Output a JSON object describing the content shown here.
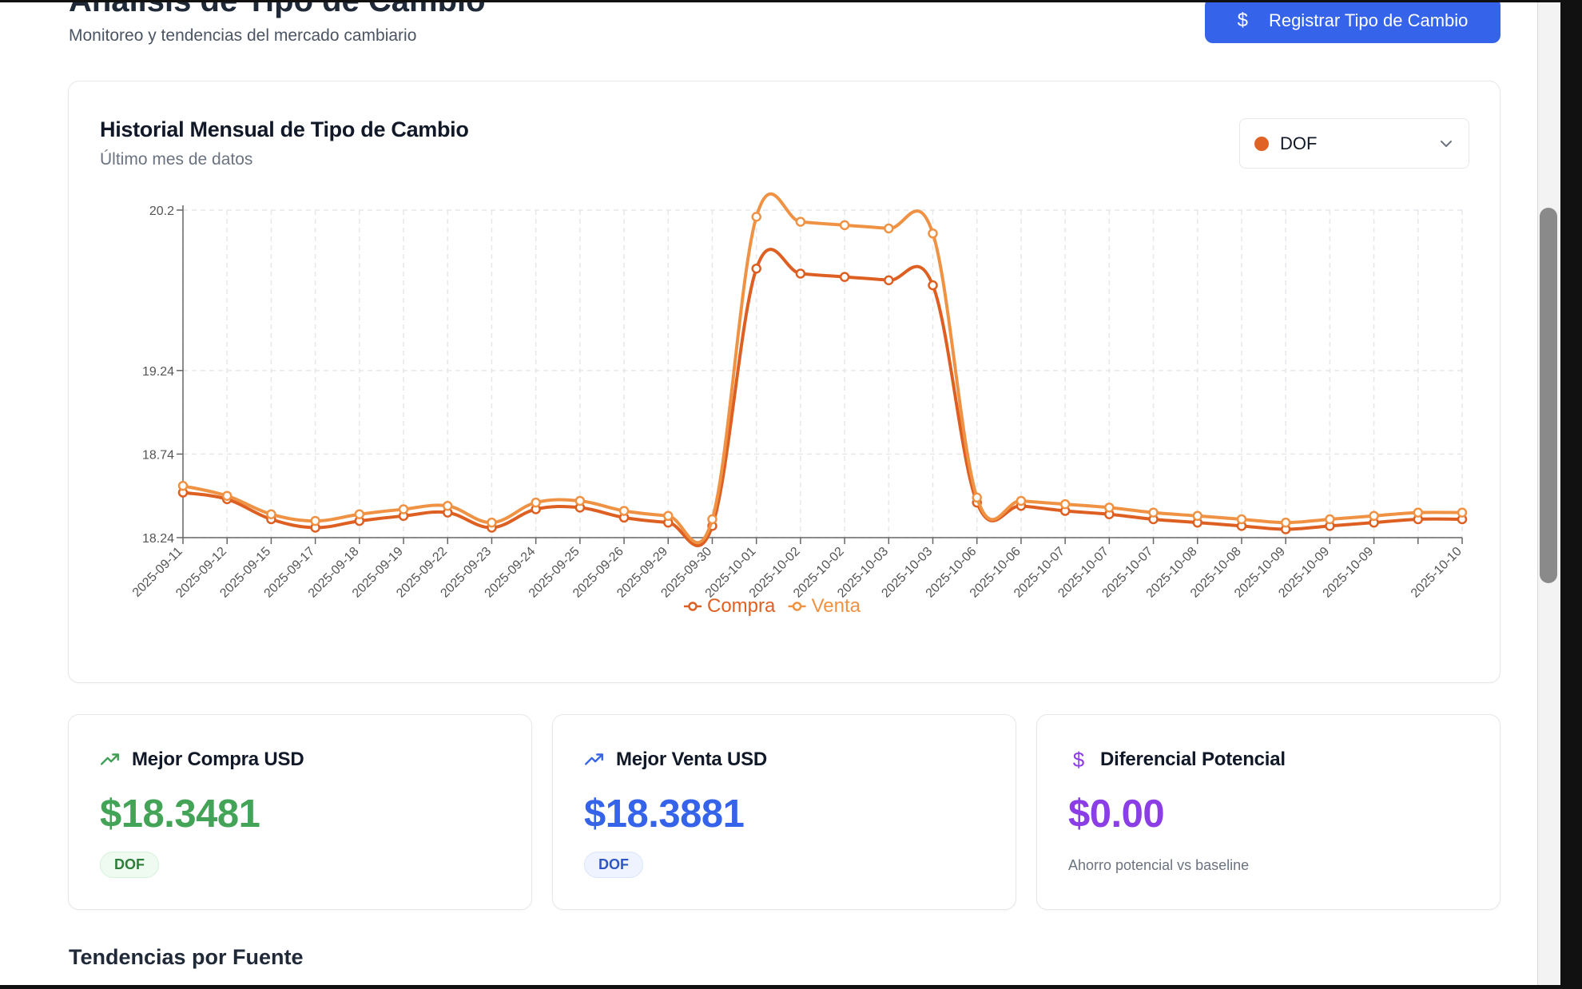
{
  "header": {
    "title": "Análisis de Tipo de Cambio",
    "subtitle": "Monitoreo y tendencias del mercado cambiario",
    "register_button": "Registrar Tipo de Cambio",
    "register_icon": "dollar-icon"
  },
  "chart_card": {
    "title": "Historial Mensual de Tipo de Cambio",
    "subtitle": "Último mes de datos",
    "source_select": {
      "value": "DOF",
      "dot_color": "#e06227"
    }
  },
  "chart_data": {
    "type": "line",
    "title": "Historial Mensual de Tipo de Cambio",
    "xlabel": "",
    "ylabel": "",
    "x": [
      "2025-09-11",
      "2025-09-12",
      "2025-09-15",
      "2025-09-17",
      "2025-09-18",
      "2025-09-19",
      "2025-09-22",
      "2025-09-23",
      "2025-09-24",
      "2025-09-25",
      "2025-09-26",
      "2025-09-29",
      "2025-09-30",
      "2025-10-01",
      "2025-10-02",
      "2025-10-02",
      "2025-10-03",
      "2025-10-03",
      "2025-10-06",
      "2025-10-06",
      "2025-10-07",
      "2025-10-07",
      "2025-10-07",
      "2025-10-08",
      "2025-10-08",
      "2025-10-09",
      "2025-10-09",
      "2025-10-09",
      "",
      "2025-10-10"
    ],
    "y_ticks": [
      18.24,
      18.74,
      19.24,
      20.2
    ],
    "ylim": [
      18.24,
      20.2
    ],
    "grid": true,
    "legend_position": "bottom",
    "series": [
      {
        "name": "Compra",
        "color": "#de5f22",
        "values": [
          18.51,
          18.47,
          18.35,
          18.3,
          18.34,
          18.37,
          18.39,
          18.3,
          18.41,
          18.42,
          18.36,
          18.33,
          18.31,
          19.85,
          19.82,
          19.8,
          19.78,
          19.75,
          18.45,
          18.43,
          18.4,
          18.38,
          18.35,
          18.33,
          18.31,
          18.29,
          18.31,
          18.33,
          18.35,
          18.35
        ]
      },
      {
        "name": "Venta",
        "color": "#ef9244",
        "values": [
          18.55,
          18.49,
          18.38,
          18.34,
          18.38,
          18.41,
          18.43,
          18.33,
          18.45,
          18.46,
          18.4,
          18.37,
          18.35,
          20.16,
          20.13,
          20.11,
          20.09,
          20.06,
          18.48,
          18.46,
          18.44,
          18.42,
          18.39,
          18.37,
          18.35,
          18.33,
          18.35,
          18.37,
          18.39,
          18.39
        ]
      }
    ]
  },
  "stats": [
    {
      "icon": "trending-up-icon",
      "icon_color": "#3f9e55",
      "label": "Mejor Compra USD",
      "value": "$18.3481",
      "value_color": "#43a356",
      "badge": "DOF"
    },
    {
      "icon": "trending-up-icon",
      "icon_color": "#3563e9",
      "label": "Mejor Venta USD",
      "value": "$18.3881",
      "value_color": "#3563e9",
      "badge": "DOF"
    },
    {
      "icon": "dollar-icon",
      "icon_color": "#8b3ee6",
      "label": "Diferencial Potencial",
      "value": "$0.00",
      "value_color": "#8b3ee6",
      "note": "Ahorro potencial vs baseline"
    }
  ],
  "section": {
    "title": "Tendencias por Fuente"
  }
}
